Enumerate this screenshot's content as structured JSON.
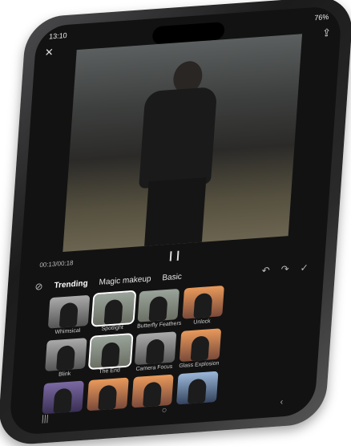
{
  "status": {
    "time": "13:10",
    "battery": "76%"
  },
  "player": {
    "time": "00:13/00:18",
    "pause_icon": "pause-icon"
  },
  "tabs": [
    "Trending",
    "Magic makeup",
    "Basic"
  ],
  "effects_top": [
    {
      "label": "Whimsical",
      "style": "dark"
    },
    {
      "label": "Spotlight",
      "style": "sel"
    },
    {
      "label": "Butterfly Feathers",
      "style": ""
    },
    {
      "label": "Unlock",
      "style": "orange"
    }
  ],
  "effects_mid": [
    {
      "label": "Blink",
      "style": "dark"
    },
    {
      "label": "The End",
      "style": "sel"
    },
    {
      "label": "Camera Focus",
      "style": "dark"
    },
    {
      "label": "Glass Explosion",
      "style": "orange"
    }
  ],
  "effects_bottom": [
    {
      "label": "",
      "style": "purple"
    },
    {
      "label": "",
      "style": "orange"
    },
    {
      "label": "",
      "style": "orange"
    },
    {
      "label": "",
      "style": "blue"
    }
  ]
}
